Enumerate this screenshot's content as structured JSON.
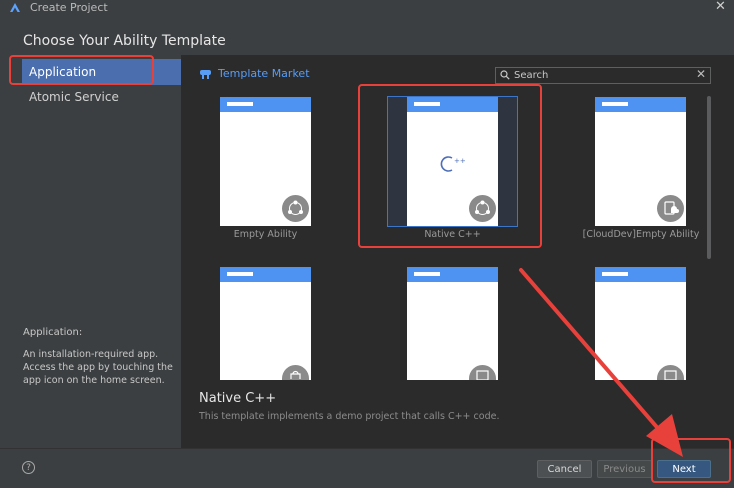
{
  "window": {
    "title": "Create Project"
  },
  "heading": "Choose Your Ability Template",
  "sidebar": {
    "items": [
      {
        "label": "Application",
        "selected": true
      },
      {
        "label": "Atomic Service",
        "selected": false
      }
    ],
    "description_title": "Application:",
    "description": "An installation-required app. Access the app by touching the app icon on the home screen."
  },
  "market": {
    "label": "Template Market"
  },
  "search": {
    "placeholder": "Search"
  },
  "templates": [
    {
      "label": "Empty Ability",
      "icon": "ability-icon"
    },
    {
      "label": "Native C++",
      "icon": "ability-icon",
      "center_icon": "cpp-icon",
      "selected": true
    },
    {
      "label": "[CloudDev]Empty Ability",
      "icon": "cloud-icon"
    },
    {
      "label": "",
      "icon": "shopping-bag-icon"
    },
    {
      "label": "",
      "icon": "image-icon"
    },
    {
      "label": "",
      "icon": "image-icon"
    }
  ],
  "detail": {
    "title": "Native C++",
    "description": "This template implements a demo project that calls C++ code."
  },
  "footer": {
    "help": "?",
    "cancel": "Cancel",
    "previous": "Previous",
    "next": "Next"
  },
  "colors": {
    "accent": "#4b6eaf",
    "link": "#589df6",
    "card_header": "#4e92f2",
    "annotation": "#e8413b"
  }
}
